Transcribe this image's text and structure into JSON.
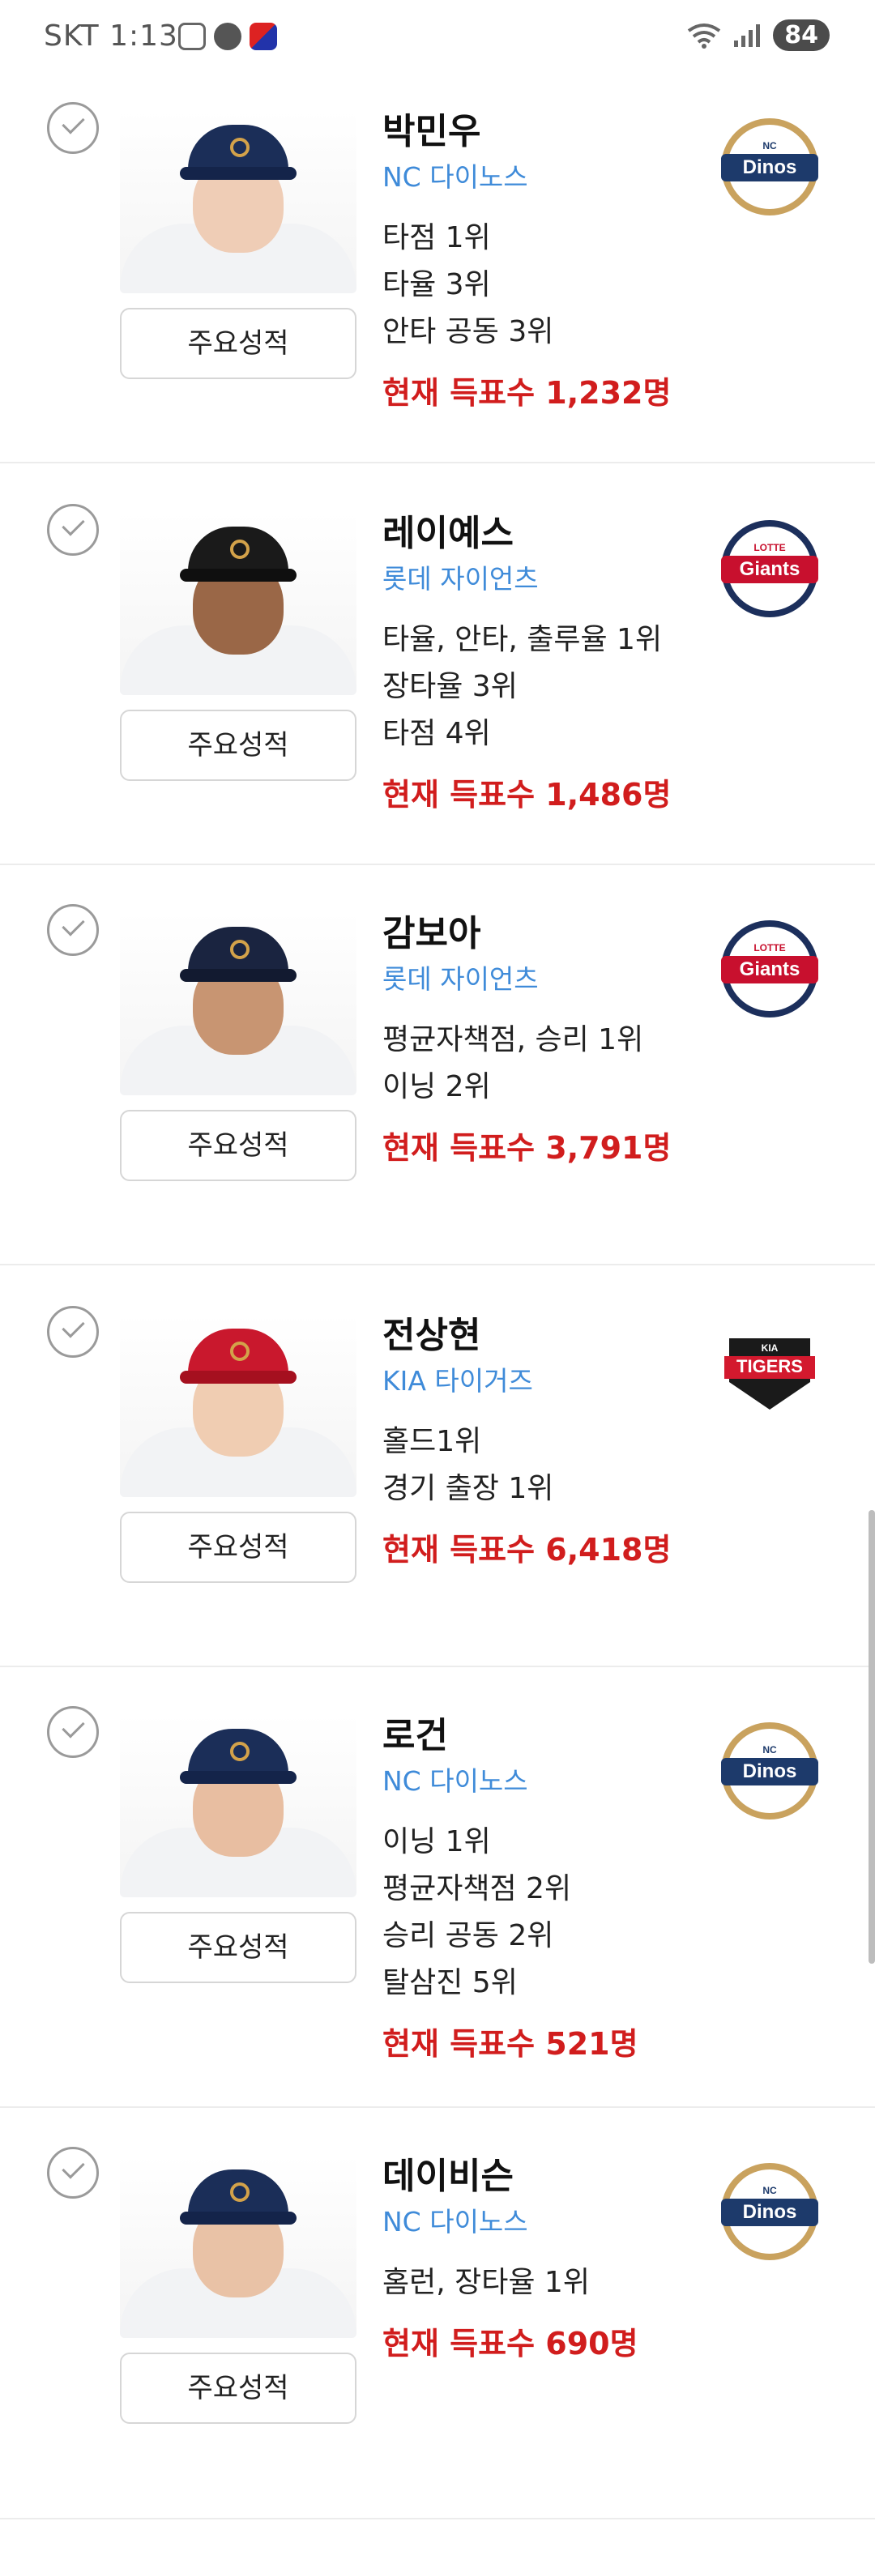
{
  "status_bar": {
    "carrier_time": "SKT 1:13",
    "battery": "84",
    "left_icons": [
      "gallery-icon",
      "talk-icon",
      "app-icon"
    ]
  },
  "common": {
    "stats_button_label": "주요성적"
  },
  "players": [
    {
      "name": "박민우",
      "team": "NC 다이노스",
      "team_logo": "dinos",
      "records": [
        "타점 1위",
        "타율 3위",
        "안타 공동 3위"
      ],
      "votes": "현재 득표수 1,232명"
    },
    {
      "name": "레이예스",
      "team": "롯데 자이언츠",
      "team_logo": "giants",
      "records": [
        "타율, 안타, 출루율 1위",
        "장타율 3위",
        "타점 4위"
      ],
      "votes": "현재 득표수 1,486명"
    },
    {
      "name": "감보아",
      "team": "롯데 자이언츠",
      "team_logo": "giants",
      "records": [
        "평균자책점, 승리 1위",
        "이닝 2위"
      ],
      "votes": "현재 득표수 3,791명"
    },
    {
      "name": "전상현",
      "team": "KIA 타이거즈",
      "team_logo": "tigers",
      "records": [
        "홀드1위",
        "경기 출장 1위"
      ],
      "votes": "현재 득표수 6,418명"
    },
    {
      "name": "로건",
      "team": "NC 다이노스",
      "team_logo": "dinos",
      "records": [
        "이닝 1위",
        "평균자책점 2위",
        "승리 공동 2위",
        "탈삼진 5위"
      ],
      "votes": "현재 득표수 521명"
    },
    {
      "name": "데이비슨",
      "team": "NC 다이노스",
      "team_logo": "dinos",
      "records": [
        "홈런, 장타율 1위"
      ],
      "votes": "현재 득표수 690명"
    }
  ],
  "logos": {
    "dinos": {
      "text": "Dinos",
      "small": "NC",
      "color": "#1d3a6b",
      "ring": "#c9a25e"
    },
    "giants": {
      "text": "Giants",
      "small": "LOTTE",
      "color": "#c8102e",
      "ring": "#1c2f5c"
    },
    "tigers": {
      "text": "TIGERS",
      "small": "KIA",
      "color": "#d3192e",
      "ring": "#111111"
    }
  }
}
